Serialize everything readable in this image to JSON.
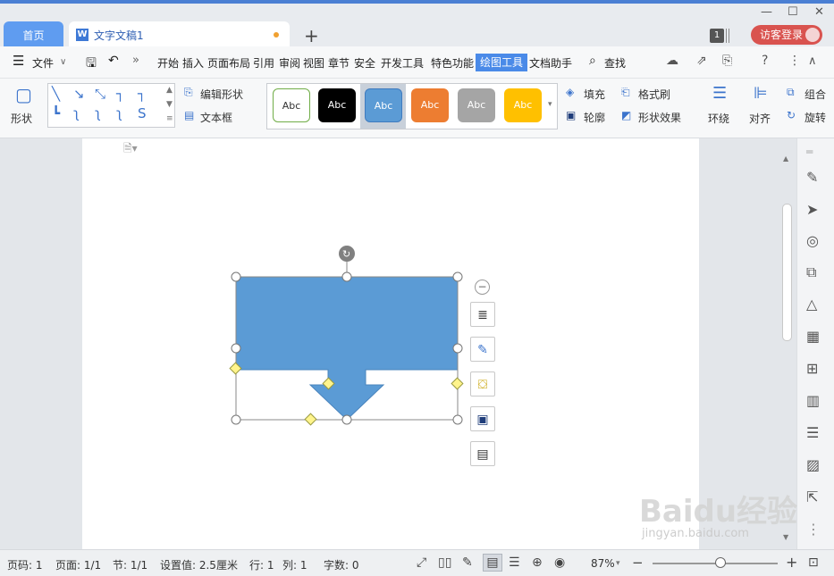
{
  "titlebar": {
    "tabs": [
      {
        "label": "首页"
      },
      {
        "label": "文字文稿1",
        "icon": "W"
      }
    ],
    "new_tab": "+",
    "badge": "1",
    "login": "访客登录",
    "window_buttons": [
      "—",
      "☐",
      "✕"
    ]
  },
  "menubar": {
    "file_label": "文件",
    "items": [
      "开始",
      "插入",
      "页面布局",
      "引用",
      "审阅",
      "视图",
      "章节",
      "安全",
      "开发工具",
      "特色功能"
    ],
    "active": "绘图工具",
    "doc_assistant": "文档助手",
    "search": "查找"
  },
  "ribbon": {
    "shape_label": "形状",
    "edit_shape": "编辑形状",
    "textbox": "文本框",
    "style_text": "Abc",
    "fill": "填充",
    "format_painter": "格式刷",
    "outline": "轮廓",
    "shape_effect": "形状效果",
    "wrap": "环绕",
    "align": "对齐",
    "group": "组合",
    "rotate": "旋转",
    "colors": {
      "accent": "#5b9bd5",
      "style_black": "#000000",
      "style_orange": "#ed7d31",
      "style_gray": "#a5a5a5",
      "style_yellow": "#ffc000"
    }
  },
  "statusbar": {
    "page_no": "页码: 1",
    "pages": "页面: 1/1",
    "section": "节: 1/1",
    "setting": "设置值: 2.5厘米",
    "row": "行: 1",
    "col": "列: 1",
    "words": "字数: 0",
    "zoom": "87%",
    "zoom_level": 0.54
  },
  "watermark": {
    "brand": "Baidu经验",
    "url": "jingyan.baidu.com"
  }
}
